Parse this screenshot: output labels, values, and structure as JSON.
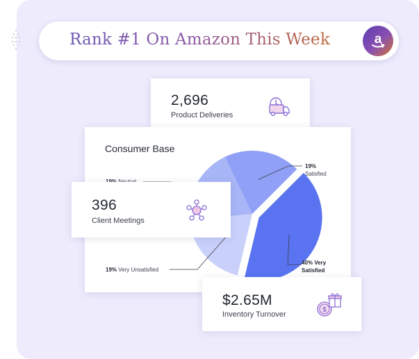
{
  "banner": {
    "text": "Rank #1 On Amazon This Week",
    "badge_icon": "amazon-logo",
    "badge_letter": "a"
  },
  "metrics": {
    "deliveries": {
      "value": "2,696",
      "label": "Product Deliveries",
      "icon": "delivery-truck-icon"
    },
    "meetings": {
      "value": "396",
      "label": "Client Meetings",
      "icon": "team-meeting-icon"
    },
    "turnover": {
      "value": "$2.65M",
      "label": "Inventory Turnover",
      "icon": "money-gift-icon"
    }
  },
  "consumer_base": {
    "title": "Consumer Base",
    "legend": {
      "neutral": {
        "pct": "19%",
        "text": "Neutral"
      },
      "satisfied": {
        "pct": "19%",
        "text": "Satisfied"
      },
      "very_unsatisfied": {
        "pct": "19%",
        "text": "Very Unsatisfied"
      },
      "very_satisfied": {
        "pct": "40%",
        "text": "Very Satisfied"
      }
    }
  },
  "chart_data": {
    "type": "pie",
    "title": "Consumer Base",
    "slices": [
      {
        "label": "Very Satisfied",
        "value": 40
      },
      {
        "label": "Very Unsatisfied",
        "value": 19
      },
      {
        "label": "Neutral",
        "value": 19
      },
      {
        "label": "Satisfied",
        "value": 19
      }
    ]
  },
  "colors": {
    "panel": "#eeebfc",
    "accent": "#5a73f0",
    "slice_dark": "#5a73f0",
    "slice_mid": "#8fa0f6",
    "slice_light": "#a8b5f7",
    "slice_lightest": "#c9d1fa",
    "icon_purple": "#8b6fd6",
    "icon_pink": "#e5a3d6"
  }
}
